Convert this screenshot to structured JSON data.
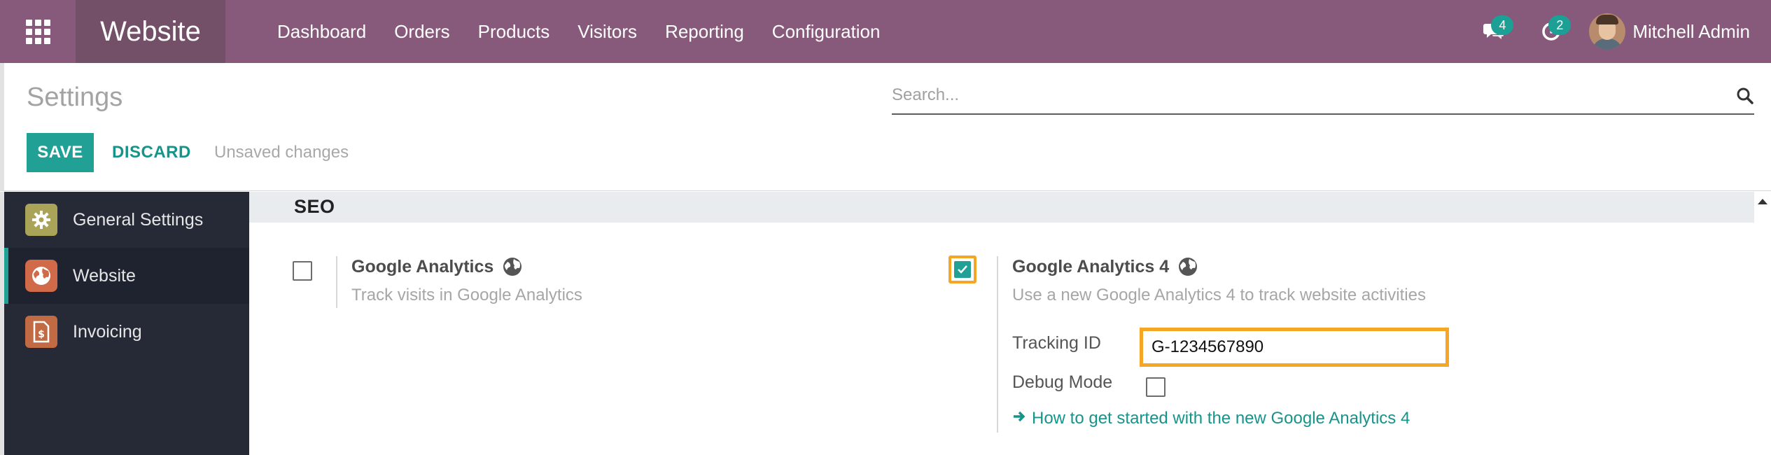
{
  "navbar": {
    "app_name": "Website",
    "menu": [
      "Dashboard",
      "Orders",
      "Products",
      "Visitors",
      "Reporting",
      "Configuration"
    ],
    "messages_count": "4",
    "activities_count": "2",
    "user_name": "Mitchell Admin",
    "icons": [
      "apps-grid-icon",
      "chat-icon",
      "clock-icon",
      "avatar"
    ]
  },
  "control": {
    "title": "Settings",
    "search_placeholder": "Search...",
    "save_label": "SAVE",
    "discard_label": "DISCARD",
    "status": "Unsaved changes"
  },
  "sidebar": {
    "items": [
      {
        "label": "General Settings",
        "icon": "gear-icon"
      },
      {
        "label": "Website",
        "icon": "globe-icon"
      },
      {
        "label": "Invoicing",
        "icon": "invoice-icon"
      }
    ],
    "active": "Website"
  },
  "section": {
    "title": "SEO",
    "ga": {
      "title": "Google Analytics",
      "description": "Track visits in Google Analytics",
      "checked": false
    },
    "ga4": {
      "title": "Google Analytics 4",
      "description": "Use a new Google Analytics 4 to track website activities",
      "checked": true,
      "tracking_label": "Tracking ID",
      "tracking_value": "G-1234567890",
      "debug_label": "Debug Mode",
      "debug_checked": false,
      "help_link": "How to get started with the new Google Analytics 4"
    }
  },
  "colors": {
    "navbar": "#875a7b",
    "brand": "#735068",
    "accent": "#21a196",
    "highlight": "#f5a623",
    "sidebar": "#262a36"
  }
}
